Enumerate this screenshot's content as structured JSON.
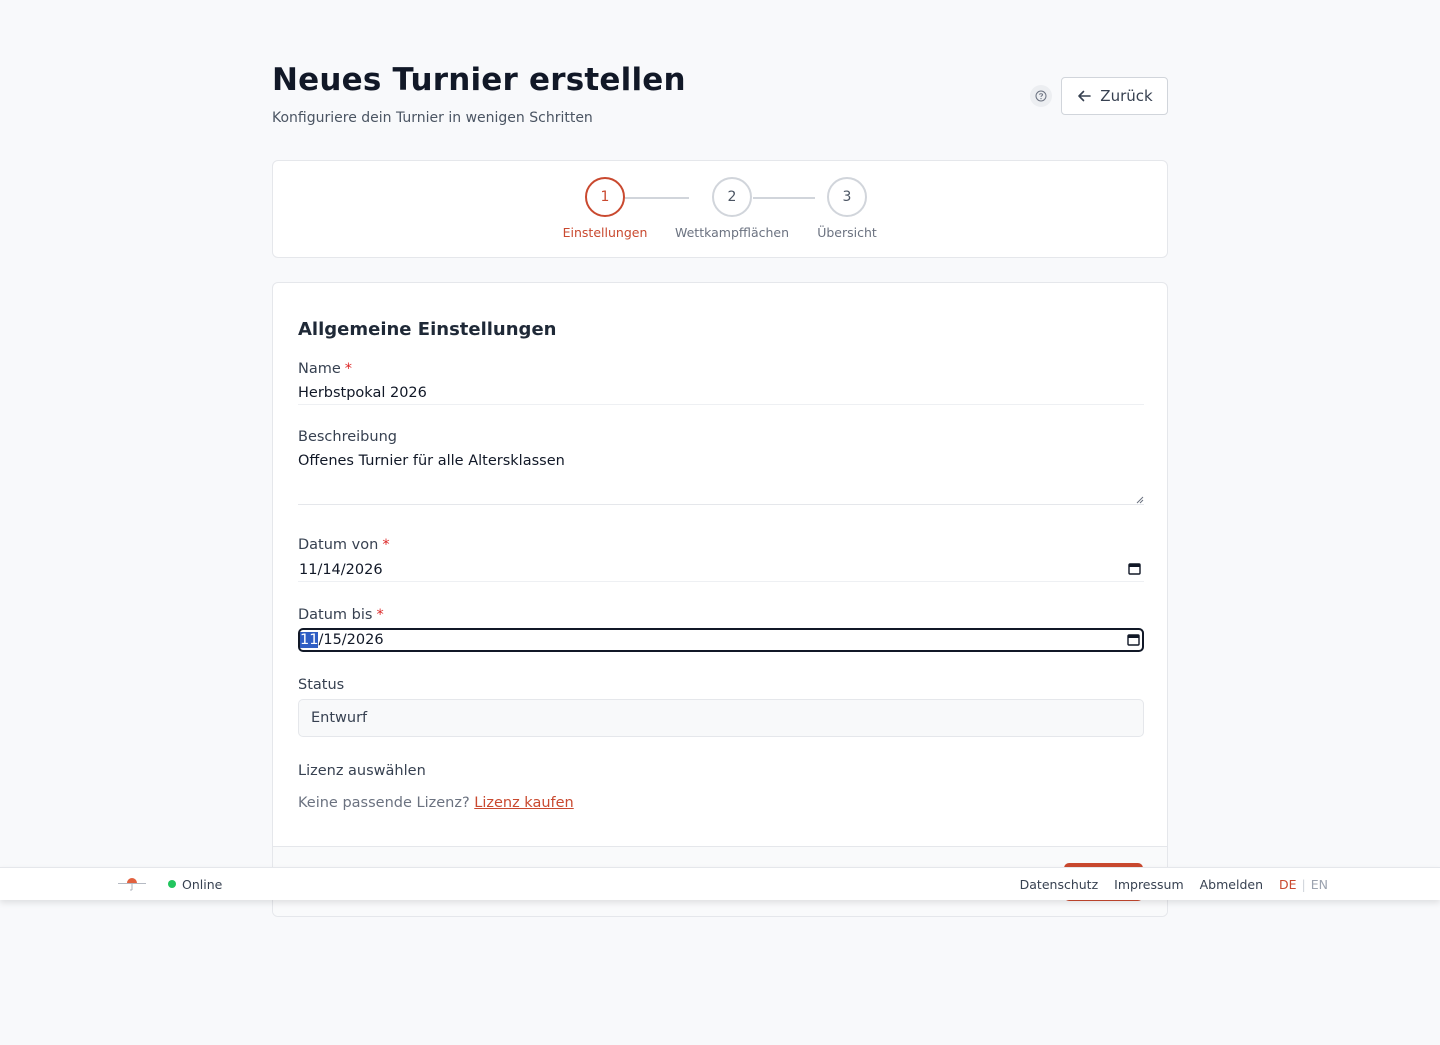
{
  "header": {
    "title": "Neues Turnier erstellen",
    "subtitle": "Konfiguriere dein Turnier in wenigen Schritten",
    "back_label": "Zurück"
  },
  "stepper": {
    "steps": [
      {
        "number": "1",
        "label": "Einstellungen",
        "active": true
      },
      {
        "number": "2",
        "label": "Wettkampfflächen",
        "active": false
      },
      {
        "number": "3",
        "label": "Übersicht",
        "active": false
      }
    ]
  },
  "form": {
    "section_title": "Allgemeine Einstellungen",
    "required_mark": "*",
    "name": {
      "label": "Name",
      "value": "Herbstpokal 2026"
    },
    "description": {
      "label": "Beschreibung",
      "value": "Offenes Turnier für alle Altersklassen"
    },
    "date_from": {
      "label": "Datum von",
      "value": "11/14/2026"
    },
    "date_to": {
      "label": "Datum bis",
      "selected_part": "11",
      "rest": "/15/2026"
    },
    "status": {
      "label": "Status",
      "value": "Entwurf"
    },
    "license": {
      "label": "Lizenz auswählen",
      "hint": "Keine passende Lizenz?",
      "link": "Lizenz kaufen"
    }
  },
  "footer": {
    "status": "Online",
    "links": [
      "Datenschutz",
      "Impressum",
      "Abmelden"
    ],
    "lang_active": "DE",
    "lang_separator": "|",
    "lang_other": "EN"
  },
  "colors": {
    "accent": "#c9492f",
    "online": "#22c55e",
    "focus_border": "#111827",
    "selection": "#2f5ec4"
  }
}
